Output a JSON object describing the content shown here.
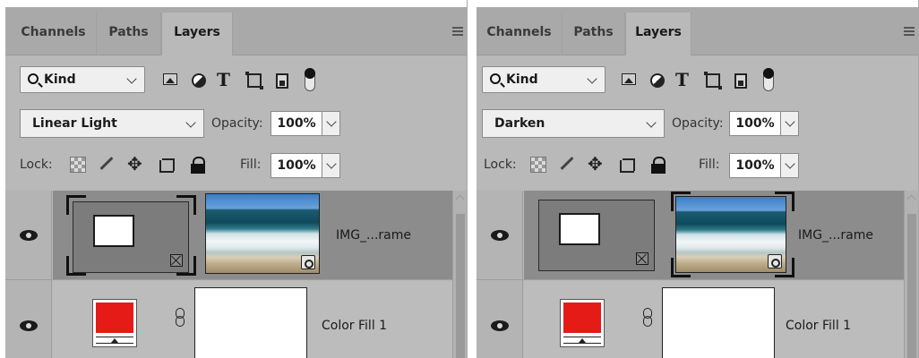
{
  "panels": [
    {
      "tabs": [
        {
          "label": "Channels",
          "active": false
        },
        {
          "label": "Paths",
          "active": false
        },
        {
          "label": "Layers",
          "active": true
        }
      ],
      "filter": {
        "kind_label": "Kind"
      },
      "blend_mode": "Linear Light",
      "opacity_label": "Opacity:",
      "opacity_value": "100%",
      "lock_label": "Lock:",
      "fill_label": "Fill:",
      "fill_value": "100%",
      "layers": [
        {
          "name": "IMG_...rame",
          "type": "frame",
          "selected": true,
          "active_thumb": "frame"
        },
        {
          "name": "Color Fill 1",
          "type": "color-fill",
          "selected": false,
          "fill_color": "#e51b17"
        }
      ]
    },
    {
      "tabs": [
        {
          "label": "Channels",
          "active": false
        },
        {
          "label": "Paths",
          "active": false
        },
        {
          "label": "Layers",
          "active": true
        }
      ],
      "filter": {
        "kind_label": "Kind"
      },
      "blend_mode": "Darken",
      "opacity_label": "Opacity:",
      "opacity_value": "100%",
      "lock_label": "Lock:",
      "fill_label": "Fill:",
      "fill_value": "100%",
      "layers": [
        {
          "name": "IMG_...rame",
          "type": "frame",
          "selected": true,
          "active_thumb": "photo"
        },
        {
          "name": "Color Fill 1",
          "type": "color-fill",
          "selected": false,
          "fill_color": "#e51b17"
        }
      ]
    }
  ],
  "icons": {
    "filter_row": [
      "search-icon",
      "image-filter-icon",
      "adjustment-filter-icon",
      "type-filter-icon",
      "shape-filter-icon",
      "smart-object-filter-icon",
      "filter-toggle-icon"
    ],
    "lock_row": [
      "lock-transparency-icon",
      "lock-brush-icon",
      "lock-position-icon",
      "lock-artboard-icon",
      "lock-all-icon"
    ],
    "layer": [
      "visibility-eye-icon",
      "frame-badge-icon",
      "smart-object-badge-icon",
      "link-chain-icon"
    ]
  },
  "colors": {
    "panel_bg": "#b9b9b9",
    "selected_row": "#8c8c8c",
    "fill_swatch": "#e51b17"
  }
}
